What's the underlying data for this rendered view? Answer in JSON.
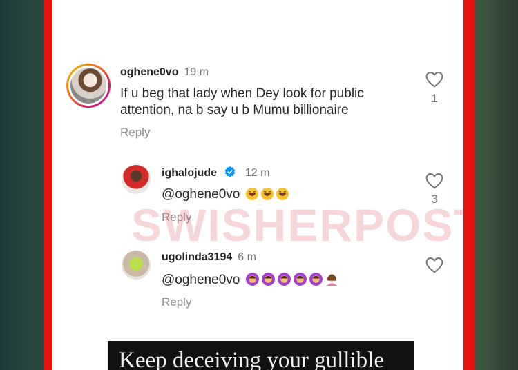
{
  "comments": [
    {
      "username": "oghene0vo",
      "time": "19 m",
      "text_line1": "If u beg that lady when Dey look for public",
      "text_line2": "attention, na b say u b Mumu billionaire",
      "reply": "Reply",
      "likes": "1"
    },
    {
      "username": "ighalojude",
      "verified": true,
      "time": "12 m",
      "mention": "@oghene0vo",
      "reply": "Reply",
      "likes": "3"
    },
    {
      "username": "ugolinda3194",
      "time": "6 m",
      "mention": "@oghene0vo",
      "reply": "Reply",
      "likes": ""
    }
  ],
  "watermark": "SWISHERPOST",
  "caption": "Keep deceiving your gullible",
  "colors": {
    "border": "#e8130f",
    "verified": "#0095f6",
    "text": "#262626",
    "muted": "#737373"
  }
}
